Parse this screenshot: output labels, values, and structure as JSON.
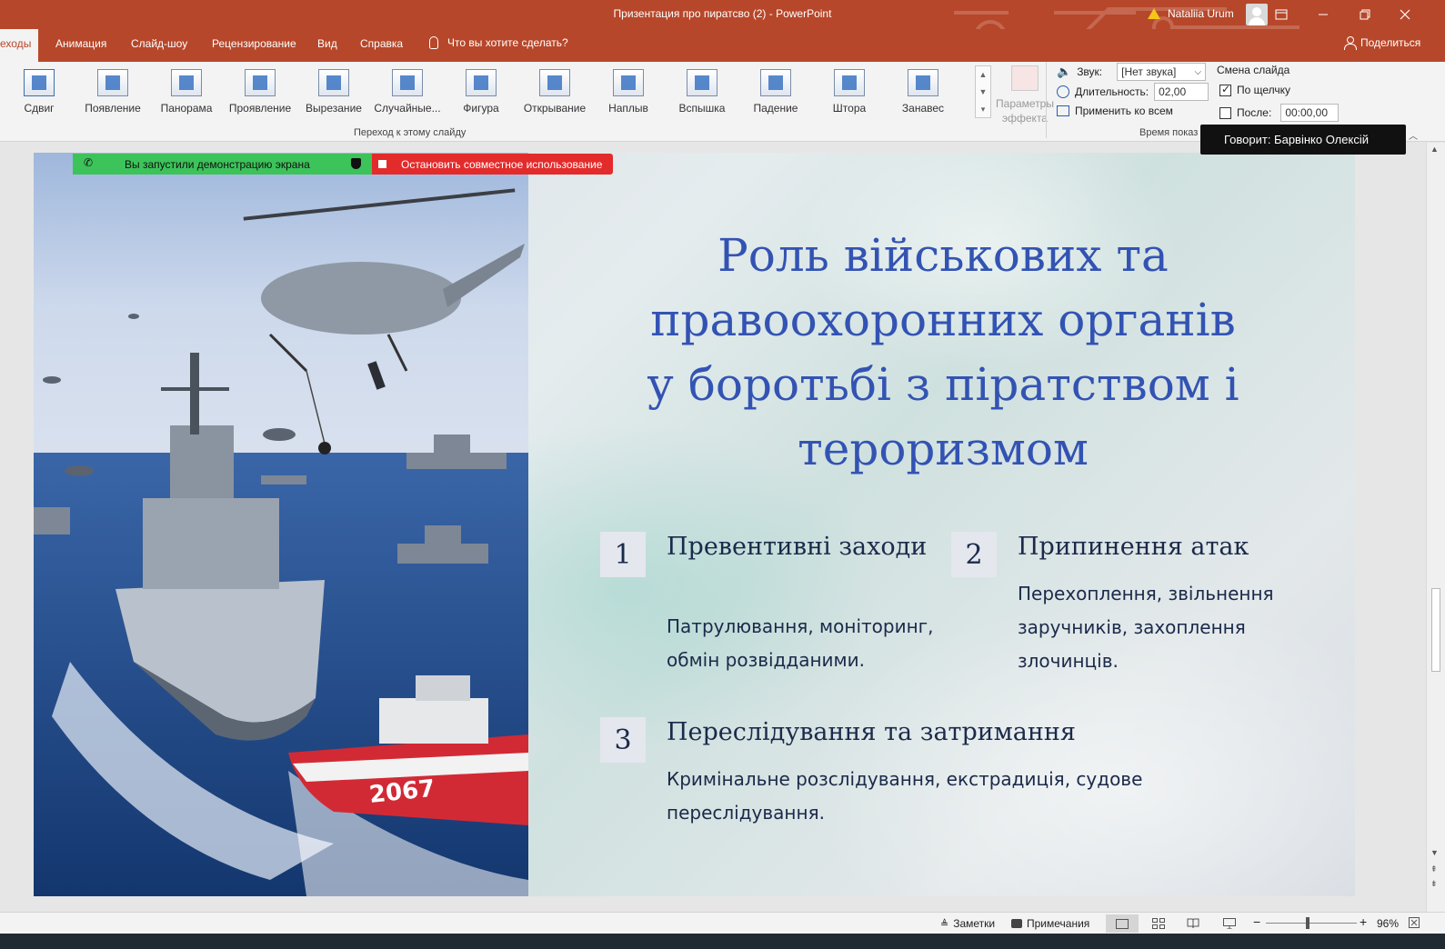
{
  "window": {
    "title": "Призентация про пиратсво (2)  -  PowerPoint",
    "user": "Nataliia Urum"
  },
  "tabs": {
    "active": "еходы",
    "items": [
      "Анимация",
      "Слайд-шоу",
      "Рецензирование",
      "Вид",
      "Справка"
    ],
    "tell_me": "Что вы хотите сделать?",
    "share": "Поделиться"
  },
  "ribbon": {
    "transitions": [
      "Сдвиг",
      "Появление",
      "Панорама",
      "Проявление",
      "Вырезание",
      "Случайные...",
      "Фигура",
      "Открывание",
      "Наплыв",
      "Вспышка",
      "Падение",
      "Штора",
      "Занавес"
    ],
    "effect_options": [
      "Параметры",
      "эффекта"
    ],
    "group_transition_label": "Переход к этому слайду",
    "sound_label": "Звук:",
    "sound_value": "[Нет звука]",
    "duration_label": "Длительность:",
    "duration_value": "02,00",
    "apply_all": "Применить ко всем",
    "advance_label": "Смена слайда",
    "on_click_label": "По щелчку",
    "after_label": "После:",
    "after_value": "00:00,00",
    "group_timing_label": "Время показ"
  },
  "share_bar": {
    "sharing_text": "Вы запустили демонстрацию экрана",
    "stop_text": "Остановить совместное использование"
  },
  "tooltip": "Говорит: Барвінко Олексій",
  "slide": {
    "title_lines": [
      "Роль військових та",
      "правоохоронних органів",
      "у боротьбі з піратством і",
      "тероризмом"
    ],
    "items": [
      {
        "num": "1",
        "heading": "Превентивні заходи",
        "body": [
          "Патрулювання, моніторинг,",
          "обмін розвідданими."
        ]
      },
      {
        "num": "2",
        "heading": "Припинення атак",
        "body": [
          "Перехоплення, звільнення",
          "заручників, захоплення",
          "злочинців."
        ]
      },
      {
        "num": "3",
        "heading": "Переслідування та затримання",
        "body": [
          "Кримінальне розслідування, екстрадиція, судове",
          "переслідування."
        ]
      }
    ],
    "photo_text": "2067"
  },
  "status": {
    "notes": "Заметки",
    "comments": "Примечания",
    "zoom_minus": "−",
    "zoom_plus": "+",
    "zoom_value": "96%"
  },
  "colors": {
    "brand": "#b7472a",
    "title": "#3353b3",
    "text_dark": "#1b2a4a",
    "share_green": "#3cc35a",
    "share_red": "#e32b2b"
  }
}
